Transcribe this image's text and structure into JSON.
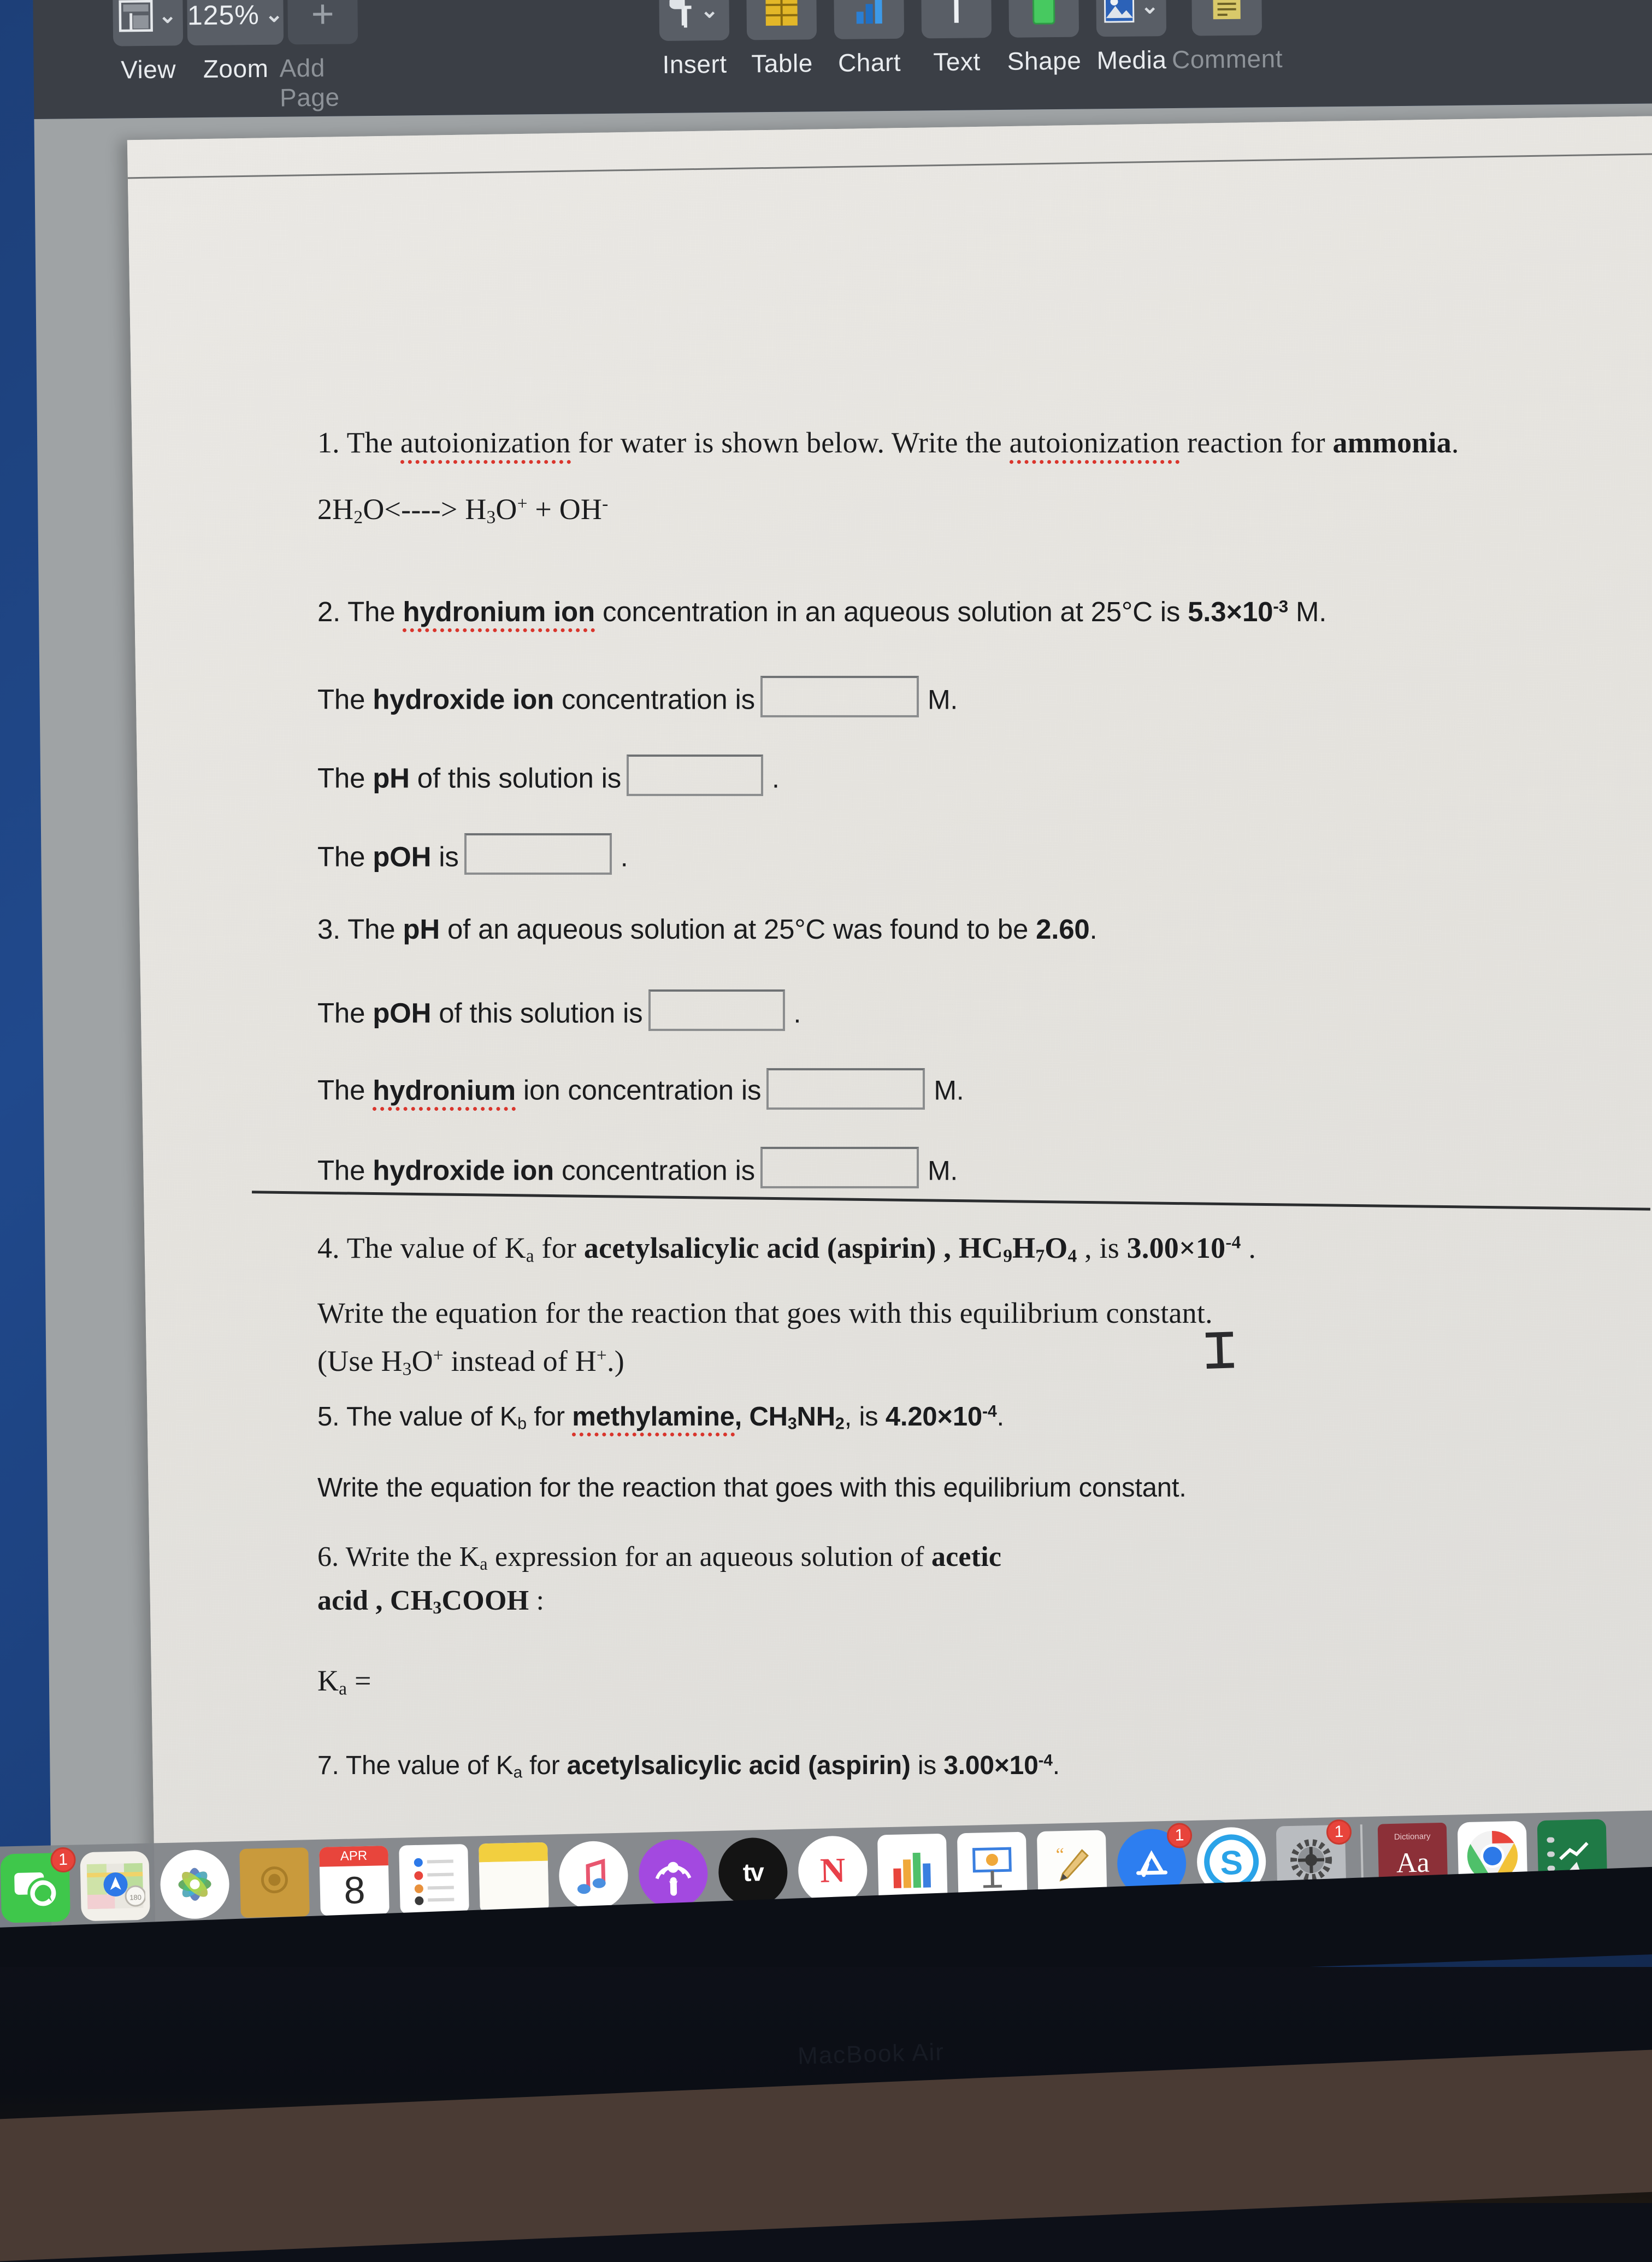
{
  "app": {
    "name": "Pages",
    "device_label": "MacBook Air"
  },
  "window_controls": {
    "close": "close",
    "minimize": "minimize",
    "zoom": "zoom"
  },
  "toolbar": {
    "items": [
      {
        "label": "View",
        "icon": "view-layout-icon",
        "value": "",
        "has_chevron": true,
        "enabled": true
      },
      {
        "label": "Zoom",
        "icon": "zoom-percent-icon",
        "value": "125%",
        "has_chevron": true,
        "enabled": true
      },
      {
        "label": "Add Page",
        "icon": "plus-icon",
        "value": "",
        "has_chevron": false,
        "enabled": false
      },
      {
        "label": "Insert",
        "icon": "pilcrow-icon",
        "value": "",
        "has_chevron": true,
        "enabled": true
      },
      {
        "label": "Table",
        "icon": "table-grid-icon",
        "value": "",
        "has_chevron": false,
        "enabled": true
      },
      {
        "label": "Chart",
        "icon": "bar-chart-icon",
        "value": "",
        "has_chevron": false,
        "enabled": true
      },
      {
        "label": "Text",
        "icon": "text-t-icon",
        "value": "",
        "has_chevron": false,
        "enabled": true
      },
      {
        "label": "Shape",
        "icon": "green-rect-icon",
        "value": "",
        "has_chevron": false,
        "enabled": true
      },
      {
        "label": "Media",
        "icon": "photo-icon",
        "value": "",
        "has_chevron": true,
        "enabled": true
      },
      {
        "label": "Comment",
        "icon": "sticky-note-icon",
        "value": "",
        "has_chevron": false,
        "enabled": false
      }
    ]
  },
  "document": {
    "q1": {
      "number": "1.",
      "text_a": "The ",
      "misspelled_a": "autoionization",
      "text_b": " for water is shown below. Write the ",
      "misspelled_b": "autoionization",
      "text_c": " reaction for ",
      "bold_c": "ammonia",
      "text_d": ".",
      "equation_prefix": "2H",
      "equation_sub1": "2",
      "equation_mid": "O<----> H",
      "equation_sub2": "3",
      "equation_o": "O",
      "equation_sup1": "+",
      "equation_plus": " +   OH",
      "equation_sup2": "-"
    },
    "q2": {
      "number": "2.",
      "text_a": "The ",
      "misspelled_a": "hydronium ion",
      "text_b": " concentration in an aqueous solution at 25°C is ",
      "value": "5.3×10",
      "value_exp": "-3",
      "unit": " M.",
      "lines": [
        {
          "label_pre": "The ",
          "label_bold": "hydroxide ion",
          "label_post": " concentration is",
          "box": "w1",
          "suffix": "M."
        },
        {
          "label_pre": "The ",
          "label_bold": "pH",
          "label_post": " of this solution is",
          "box": "w2",
          "suffix": "."
        },
        {
          "label_pre": "The ",
          "label_bold": "pOH",
          "label_post": " is",
          "box": "w3",
          "suffix": "."
        }
      ]
    },
    "q3": {
      "number": "3.",
      "text_a": "The ",
      "bold_a": "pH",
      "text_b": " of an aqueous solution at 25°C was found to be ",
      "value": "2.60",
      "text_c": ".",
      "lines": [
        {
          "label_pre": "The ",
          "label_bold": "pOH",
          "label_post": " of this solution is",
          "box": "w2",
          "suffix": "."
        },
        {
          "label_pre": "The ",
          "label_misspelled": "hydronium",
          "label_post": " ion concentration is",
          "box": "w1",
          "suffix": "M."
        },
        {
          "label_pre": "The ",
          "label_bold": "hydroxide ion",
          "label_post": " concentration is",
          "box": "w1",
          "suffix": "M."
        }
      ]
    },
    "q4": {
      "number": "4.",
      "text_a": "The value of K",
      "sub_a": "a",
      "text_b": " for ",
      "bold_b": "acetylsalicylic acid (aspirin)",
      "text_c": " , HC",
      "sub_c": "9",
      "text_d": "H",
      "sub_d": "7",
      "text_e": "O",
      "sub_e": "4",
      "text_f": " , is ",
      "bold_f": "3.00×10",
      "sup_f": "-4",
      "text_g": " .",
      "line2": "Write the equation for the reaction that goes with this equilibrium constant.",
      "line3_a": "(Use H",
      "line3_sub": "3",
      "line3_b": "O",
      "line3_sup": "+",
      "line3_c": " instead of H",
      "line3_sup2": "+",
      "line3_d": ".)"
    },
    "q5": {
      "number": "5.",
      "text_a": "The value of K",
      "sub_a": "b",
      "text_b": " for ",
      "misspelled_b": "methylamine",
      "text_c": ", CH",
      "sub_c": "3",
      "text_d": "NH",
      "sub_d": "2",
      "text_e": ", is ",
      "bold_e": "4.20×10",
      "sup_e": "-4",
      "text_f": ".",
      "line2": "Write the equation for the reaction that goes with this equilibrium constant."
    },
    "q6": {
      "number": "6.",
      "text_a": "Write the K",
      "sub_a": "a",
      "text_b": " expression for an aqueous solution of ",
      "bold_b": "acetic",
      "line2_bold": "acid , CH",
      "line2_sub": "3",
      "line2_bold2": "COOH",
      "line2_colon": " :",
      "expr_a": "K",
      "expr_sub": "a",
      "expr_b": " ="
    },
    "q7": {
      "number": "7.",
      "text_a": "The value of K",
      "sub_a": "a",
      "text_b": " for ",
      "bold_b": "acetylsalicylic acid (aspirin)",
      "text_c": " is ",
      "bold_c": "3.00×10",
      "sup_c": "-4",
      "text_d": "."
    }
  },
  "dock": {
    "items": [
      {
        "name": "messages",
        "label": "Messages",
        "badge": "1",
        "running": false
      },
      {
        "name": "maps",
        "label": "Maps",
        "badge": "",
        "running": false
      },
      {
        "name": "photos",
        "label": "Photos",
        "badge": "",
        "running": false
      },
      {
        "name": "contacts",
        "label": "Contacts",
        "badge": "",
        "running": false
      },
      {
        "name": "calendar",
        "label": "Calendar",
        "badge": "",
        "running": true,
        "month": "APR",
        "day": "8"
      },
      {
        "name": "reminders",
        "label": "Reminders",
        "badge": "",
        "running": false
      },
      {
        "name": "notes",
        "label": "Notes",
        "badge": "",
        "running": false
      },
      {
        "name": "music",
        "label": "Music",
        "badge": "",
        "running": false
      },
      {
        "name": "podcasts",
        "label": "Podcasts",
        "badge": "",
        "running": false
      },
      {
        "name": "apple-tv",
        "label": "TV",
        "badge": "",
        "running": false
      },
      {
        "name": "news",
        "label": "News",
        "badge": "",
        "running": false
      },
      {
        "name": "numbers",
        "label": "Numbers",
        "badge": "",
        "running": true
      },
      {
        "name": "keynote",
        "label": "Keynote",
        "badge": "",
        "running": false
      },
      {
        "name": "pages",
        "label": "Pages",
        "badge": "",
        "running": true
      },
      {
        "name": "app-store",
        "label": "App Store",
        "badge": "1",
        "running": false
      },
      {
        "name": "skype",
        "label": "Skype",
        "badge": "",
        "running": false
      },
      {
        "name": "system-preferences",
        "label": "System Preferences",
        "badge": "1",
        "running": false
      },
      {
        "name": "separator",
        "label": "",
        "badge": "",
        "running": false
      },
      {
        "name": "dictionary",
        "label": "Dictionary",
        "badge": "",
        "running": true
      },
      {
        "name": "chrome",
        "label": "Google Chrome",
        "badge": "",
        "running": true
      },
      {
        "name": "excel",
        "label": "Microsoft Excel",
        "badge": "",
        "running": true
      }
    ],
    "calendar_month": "APR",
    "calendar_day": "8",
    "dictionary_glyph": "Aa",
    "apple_tv_glyph": "tv",
    "skype_glyph": "S",
    "news_glyph": "N"
  },
  "colors": {
    "toolbar_bg": "#3b3f46",
    "doc_bg": "#9fa3a5",
    "page_bg": "#e9e8e4",
    "desktop": "#1d3f78",
    "spellcheck_red": "#d9352c",
    "accent_green": "#3fbf4b",
    "accent_red": "#e8473f",
    "accent_yellow": "#e3b341"
  }
}
